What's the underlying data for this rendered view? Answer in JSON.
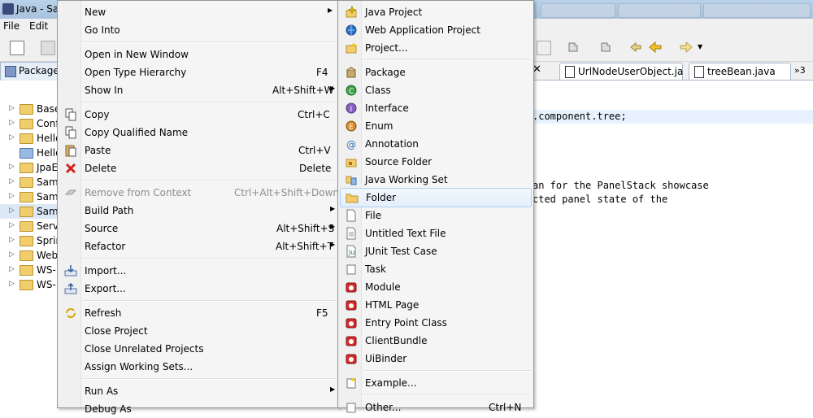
{
  "window": {
    "title": "Java - Sam"
  },
  "menubar": {
    "file": "File",
    "edit": "Edit"
  },
  "package_explorer": {
    "tab_label": "Package",
    "items": [
      {
        "label": "Base"
      },
      {
        "label": "Conf"
      },
      {
        "label": "Hello"
      },
      {
        "label": "Hello"
      },
      {
        "label": "JpaE"
      },
      {
        "label": "Sam"
      },
      {
        "label": "Sam"
      },
      {
        "label": "Sam"
      },
      {
        "label": "Serv"
      },
      {
        "label": "Sprin"
      },
      {
        "label": "Web"
      },
      {
        "label": "WS-"
      },
      {
        "label": "WS-"
      }
    ]
  },
  "editor": {
    "tabs": [
      "UrlNodeUserObject.ja",
      "treeBean.java"
    ],
    "overflow": "»3",
    "lines": {
      "line1": ".component.tree;",
      "line2": "an for the PanelStack showcase",
      "line3": "cted panel state of the"
    }
  },
  "context_menu": {
    "new": "New",
    "go_into": "Go Into",
    "open_new_window": "Open in New Window",
    "open_type_hierarchy": "Open Type Hierarchy",
    "open_type_hierarchy_key": "F4",
    "show_in": "Show In",
    "show_in_key": "Alt+Shift+W",
    "copy": "Copy",
    "copy_key": "Ctrl+C",
    "copy_qualified": "Copy Qualified Name",
    "paste": "Paste",
    "paste_key": "Ctrl+V",
    "delete": "Delete",
    "delete_key": "Delete",
    "remove_context": "Remove from Context",
    "remove_context_key": "Ctrl+Alt+Shift+Down",
    "build_path": "Build Path",
    "source": "Source",
    "source_key": "Alt+Shift+S",
    "refactor": "Refactor",
    "refactor_key": "Alt+Shift+T",
    "import": "Import...",
    "export": "Export...",
    "refresh": "Refresh",
    "refresh_key": "F5",
    "close_project": "Close Project",
    "close_unrelated": "Close Unrelated Projects",
    "assign_working_sets": "Assign Working Sets...",
    "run_as": "Run As",
    "debug_as": "Debug As"
  },
  "new_submenu": {
    "java_project": "Java Project",
    "web_app_project": "Web Application Project",
    "project": "Project...",
    "package": "Package",
    "class": "Class",
    "interface": "Interface",
    "enum": "Enum",
    "annotation": "Annotation",
    "source_folder": "Source Folder",
    "java_working_set": "Java Working Set",
    "folder": "Folder",
    "file": "File",
    "untitled_text_file": "Untitled Text File",
    "junit_test_case": "JUnit Test Case",
    "task": "Task",
    "module": "Module",
    "html_page": "HTML Page",
    "entry_point_class": "Entry Point Class",
    "client_bundle": "ClientBundle",
    "ui_binder": "UiBinder",
    "example": "Example...",
    "other": "Other...",
    "other_key": "Ctrl+N"
  },
  "colors": {
    "menu_bg": "#f5f5f5",
    "hover_border": "#aecff7",
    "comment": "#3f5fbf"
  }
}
